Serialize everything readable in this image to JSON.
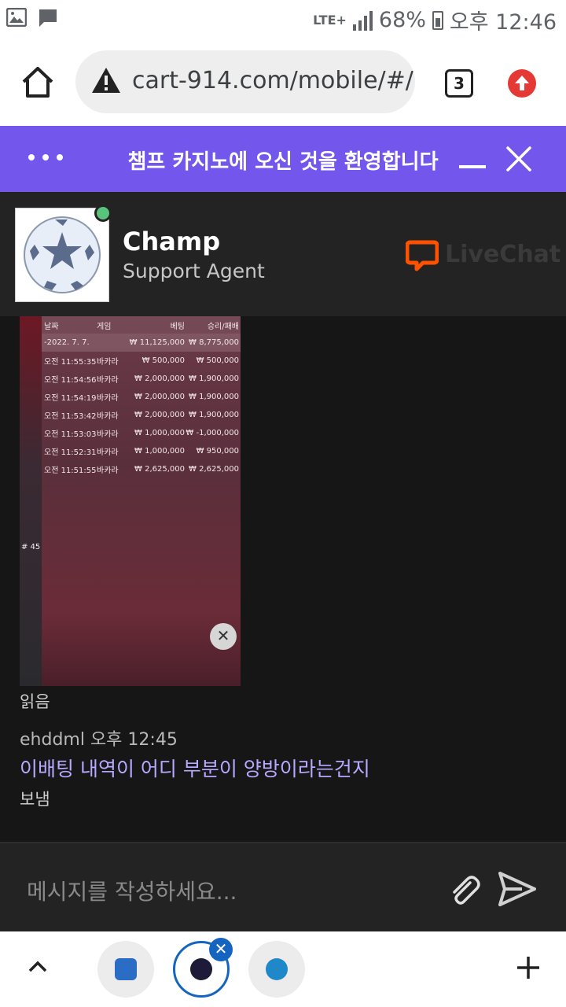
{
  "status_bar": {
    "network": "LTE+",
    "battery": "68%",
    "time": "오후 12:46",
    "icons": [
      "gallery-icon",
      "message-icon",
      "signal-icon",
      "battery-icon"
    ]
  },
  "browser": {
    "url": "cart-914.com/mobile/#/",
    "tab_count": "3",
    "icons": [
      "home-icon",
      "warning-icon",
      "upload-icon"
    ]
  },
  "chat_header": {
    "title": "챔프 카지노에 오신 것을 환영합니다"
  },
  "agent": {
    "name": "Champ",
    "role": "Support Agent",
    "brand": "LiveChat",
    "online": true
  },
  "screenshot_attachment": {
    "headers": [
      "날짜",
      "게임",
      "베팅",
      "승리/패배"
    ],
    "total": {
      "date": "-2022. 7. 7.",
      "game": "",
      "bet": "₩ 11,125,000",
      "result": "₩ 8,775,000"
    },
    "rows": [
      {
        "date": "오전 11:55:35",
        "game": "바카라",
        "bet": "₩ 500,000",
        "result": "₩ 500,000"
      },
      {
        "date": "오전 11:54:56",
        "game": "바카라",
        "bet": "₩ 2,000,000",
        "result": "₩ 1,900,000"
      },
      {
        "date": "오전 11:54:19",
        "game": "바카라",
        "bet": "₩ 2,000,000",
        "result": "₩ 1,900,000"
      },
      {
        "date": "오전 11:53:42",
        "game": "바카라",
        "bet": "₩ 2,000,000",
        "result": "₩ 1,900,000"
      },
      {
        "date": "오전 11:53:03",
        "game": "바카라",
        "bet": "₩ 1,000,000",
        "result": "₩ -1,000,000"
      },
      {
        "date": "오전 11:52:31",
        "game": "바카라",
        "bet": "₩ 1,000,000",
        "result": "₩ 950,000"
      },
      {
        "date": "오전 11:51:55",
        "game": "바카라",
        "bet": "₩ 2,625,000",
        "result": "₩ 2,625,000"
      }
    ],
    "side_label": "# 45"
  },
  "messages": {
    "read_label": "읽음",
    "sender": "ehddml 오후 12:45",
    "text": "이배팅 내역이 어디 부분이 양방이라는건지",
    "sent_label": "보냄"
  },
  "composer": {
    "placeholder": "메시지를 작성하세요..."
  },
  "bottom_bar": {
    "tabs": [
      "tab-1",
      "tab-2",
      "tab-3"
    ]
  },
  "colors": {
    "accent": "#7357ec",
    "online": "#59c37b",
    "message_text": "#b9a8ff",
    "livechat_orange": "#ff5100"
  }
}
